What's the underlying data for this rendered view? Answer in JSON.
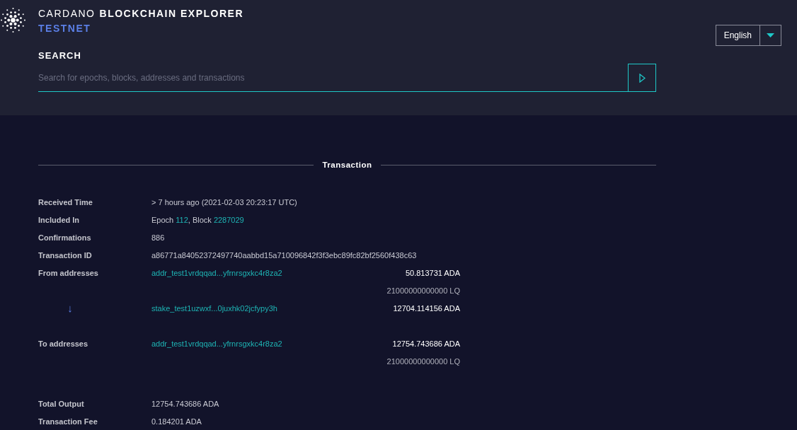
{
  "header": {
    "brand_light": "CARDANO",
    "brand_bold": "BLOCKCHAIN EXPLORER",
    "network": "TESTNET",
    "language": "English"
  },
  "search": {
    "label": "SEARCH",
    "placeholder": "Search for epochs, blocks, addresses and transactions"
  },
  "section_title": "Transaction",
  "details": [
    {
      "label": "Received Time",
      "segments": [
        {
          "kind": "text",
          "text": "> 7 hours ago (2021-02-03 20:23:17 UTC)"
        }
      ]
    },
    {
      "label": "Included In",
      "segments": [
        {
          "kind": "text",
          "text": "Epoch "
        },
        {
          "kind": "link",
          "text": "112"
        },
        {
          "kind": "text",
          "text": ", Block "
        },
        {
          "kind": "link",
          "text": "2287029"
        }
      ]
    },
    {
      "label": "Confirmations",
      "segments": [
        {
          "kind": "text",
          "text": "886"
        }
      ]
    },
    {
      "label": "Transaction ID",
      "segments": [
        {
          "kind": "text",
          "text": "a86771a84052372497740aabbd15a710096842f3f3ebc89fc82bf2560f438c63"
        }
      ]
    }
  ],
  "from": {
    "label": "From addresses",
    "entries": [
      {
        "address": "addr_test1vrdqqad...yfrnrsgxkc4r8za2",
        "amounts": [
          {
            "kind": "ada",
            "text": "50.813731 ADA"
          },
          {
            "kind": "token",
            "text": "21000000000000 LQ"
          }
        ]
      },
      {
        "address": "stake_test1uzwxf...0juxhk02jcfypy3h",
        "amounts": [
          {
            "kind": "ada",
            "text": "12704.114156 ADA"
          }
        ]
      }
    ]
  },
  "flow_arrow": "↓",
  "to": {
    "label": "To addresses",
    "entries": [
      {
        "address": "addr_test1vrdqqad...yfrnrsgxkc4r8za2",
        "amounts": [
          {
            "kind": "ada",
            "text": "12754.743686 ADA"
          },
          {
            "kind": "token",
            "text": "21000000000000 LQ"
          }
        ]
      }
    ]
  },
  "totals": [
    {
      "label": "Total Output",
      "value": "12754.743686 ADA"
    },
    {
      "label": "Transaction Fee",
      "value": "0.184201 ADA"
    }
  ]
}
